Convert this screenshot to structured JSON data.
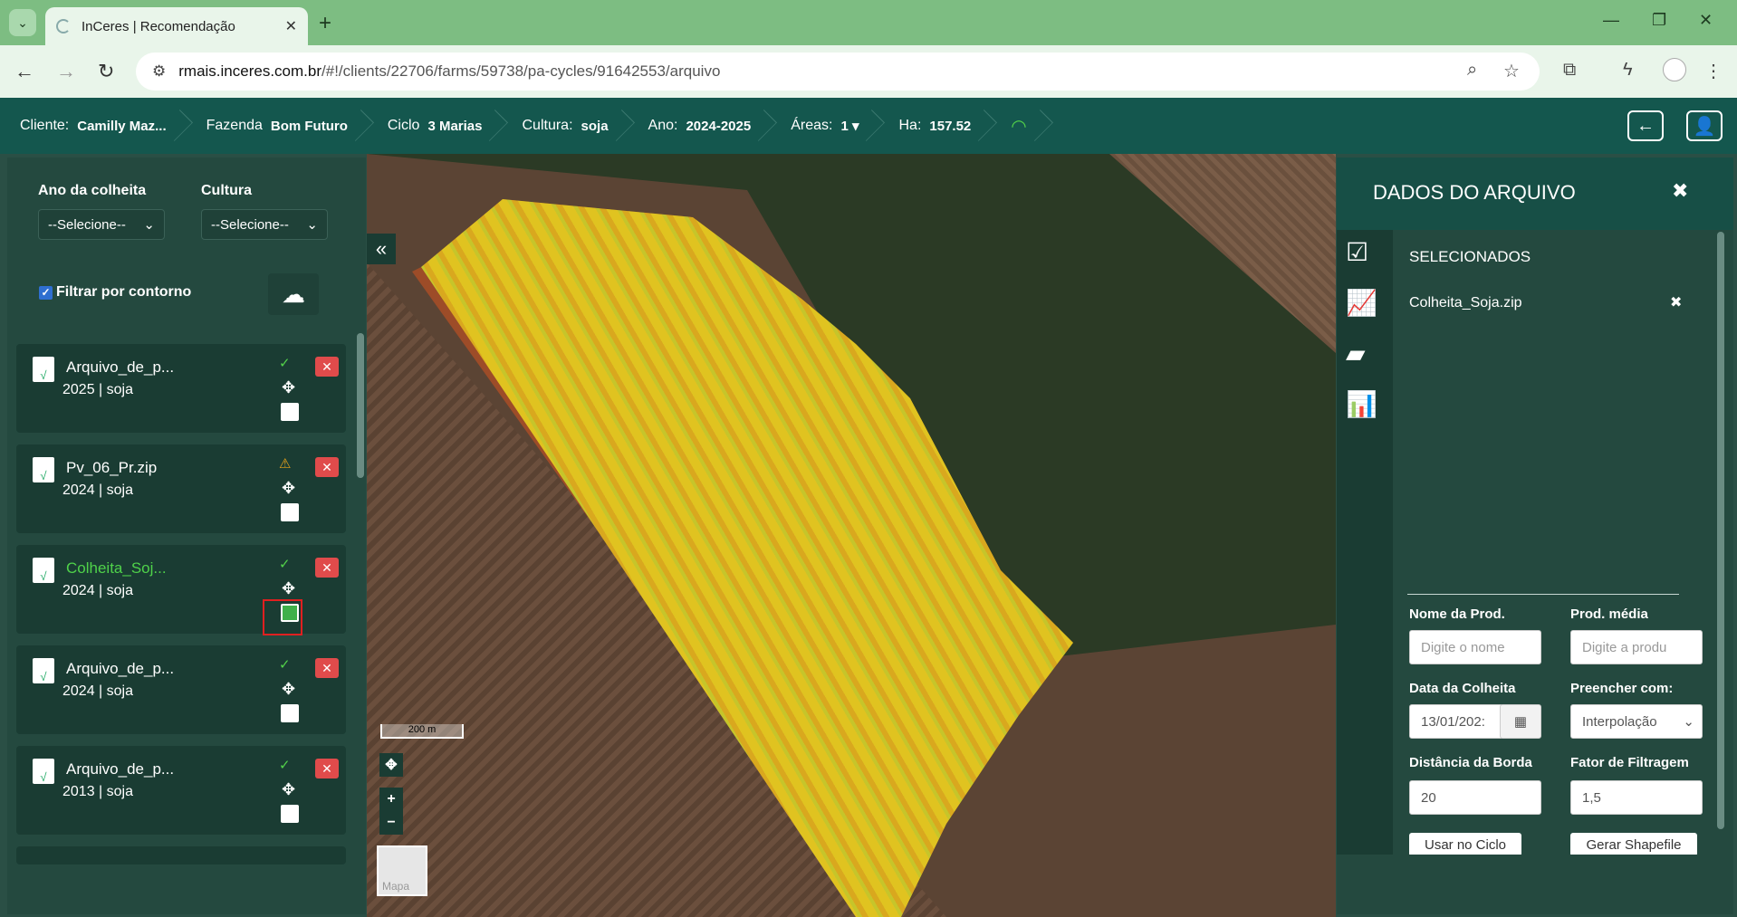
{
  "browser": {
    "tab_title": "InCeres | Recomendação",
    "url_host": "rmais.inceres.com.br",
    "url_path": "/#!/clients/22706/farms/59738/pa-cycles/91642553/arquivo"
  },
  "breadcrumbs": [
    {
      "key": "Cliente:",
      "value": "Camilly Maz..."
    },
    {
      "key": "Fazenda",
      "value": "Bom Futuro"
    },
    {
      "key": "Ciclo",
      "value": "3 Marias"
    },
    {
      "key": "Cultura:",
      "value": "soja"
    },
    {
      "key": "Ano:",
      "value": "2024-2025"
    },
    {
      "key": "Áreas:",
      "value": "1 ▾"
    },
    {
      "key": "Ha:",
      "value": "157.52"
    }
  ],
  "filters": {
    "year_label": "Ano da colheita",
    "year_value": "--Selecione--",
    "crop_label": "Cultura",
    "crop_value": "--Selecione--",
    "contour_label": "Filtrar por contorno"
  },
  "files": [
    {
      "name": "Arquivo_de_p...",
      "meta": "2025 | soja",
      "status": "✓"
    },
    {
      "name": "Pv_06_Pr.zip",
      "meta": "2024 | soja",
      "status": "⚠"
    },
    {
      "name": "Colheita_Soj...",
      "meta": "2024 | soja",
      "status": "✓"
    },
    {
      "name": "Arquivo_de_p...",
      "meta": "2024 | soja",
      "status": "✓"
    },
    {
      "name": "Arquivo_de_p...",
      "meta": "2013 | soja",
      "status": "✓"
    }
  ],
  "map": {
    "scale": "200 m",
    "layer": "Mapa"
  },
  "panel": {
    "title": "DADOS DO ARQUIVO",
    "selected_heading": "SELECIONADOS",
    "selected_file": "Colheita_Soja.zip",
    "prod_name_label": "Nome da Prod.",
    "prod_name_placeholder": "Digite o nome",
    "prod_avg_label": "Prod. média",
    "prod_avg_placeholder": "Digite a produ",
    "harvest_date_label": "Data da Colheita",
    "harvest_date_value": "13/01/202:",
    "fill_label": "Preencher com:",
    "fill_value": "Interpolação",
    "edge_label": "Distância da Borda",
    "edge_value": "20",
    "filter_label": "Fator de Filtragem",
    "filter_value": "1,5",
    "use_cycle": "Usar no Ciclo",
    "gen_shape": "Gerar Shapefile"
  },
  "colors": {
    "header": "#14574e",
    "panel": "#24493f",
    "danger": "#e04b4b",
    "ok": "#53d24a"
  }
}
